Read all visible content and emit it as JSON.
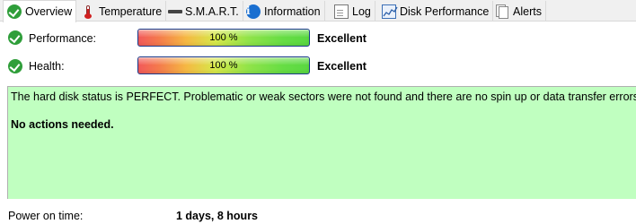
{
  "tabs": [
    {
      "label": "Overview",
      "icon": "check-icon"
    },
    {
      "label": "Temperature",
      "icon": "thermometer-icon"
    },
    {
      "label": "S.M.A.R.T.",
      "icon": "drive-icon"
    },
    {
      "label": "Information",
      "icon": "info-icon"
    },
    {
      "label": "Log",
      "icon": "document-icon"
    },
    {
      "label": "Disk Performance",
      "icon": "chart-icon"
    },
    {
      "label": "Alerts",
      "icon": "alerts-icon"
    }
  ],
  "status": {
    "performance": {
      "label": "Performance:",
      "value_text": "100 %",
      "value": 100,
      "rating": "Excellent"
    },
    "health": {
      "label": "Health:",
      "value_text": "100 %",
      "value": 100,
      "rating": "Excellent"
    }
  },
  "message": {
    "line1": "The hard disk status is PERFECT. Problematic or weak sectors were not found and there are no spin up or data transfer errors.",
    "line2": "No actions needed.",
    "background": "#c0ffc0"
  },
  "power_on": {
    "label": "Power on time:",
    "value": "1 days, 8 hours"
  },
  "colors": {
    "ok_green": "#2f9e3a",
    "bar_border": "#1b3a8a",
    "info_blue": "#1a6fd0"
  }
}
